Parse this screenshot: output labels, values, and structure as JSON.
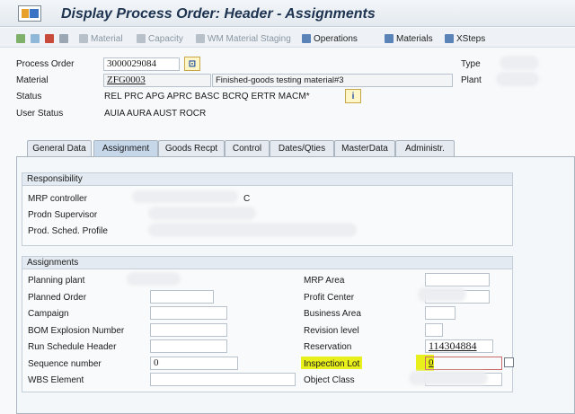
{
  "title": "Display Process Order: Header - Assignments",
  "toolbar": {
    "items": [
      {
        "label": "Material",
        "dim": true,
        "icon": "material-icon",
        "color": "#9aa6b2"
      },
      {
        "label": "Capacity",
        "dim": true,
        "icon": "capacity-icon",
        "color": "#9aa6b2"
      },
      {
        "label": "WM Material Staging",
        "dim": true,
        "icon": "wm-staging-icon",
        "color": "#9aa6b2"
      },
      {
        "label": "Operations",
        "dim": false,
        "icon": "operations-icon",
        "color": "#3a72c4"
      },
      {
        "label": "Materials",
        "dim": false,
        "icon": "materials-icon",
        "color": "#3a72c4"
      },
      {
        "label": "XSteps",
        "dim": false,
        "icon": "xsteps-icon",
        "color": "#3a72c4"
      }
    ]
  },
  "header": {
    "process_order_label": "Process Order",
    "process_order_value": "3000029084",
    "type_label": "Type",
    "material_label": "Material",
    "material_value": "ZFG0003",
    "material_desc": "Finished-goods testing material#3",
    "plant_label": "Plant",
    "status_label": "Status",
    "status_value": "REL  PRC  APG  APRC BASC BCRQ ERTR MACM*",
    "user_status_label": "User Status",
    "user_status_value": "AUIA AURA AUST ROCR",
    "info_icon": "i"
  },
  "tabs": [
    {
      "label": "General Data",
      "active": false
    },
    {
      "label": "Assignment",
      "active": true
    },
    {
      "label": "Goods Recpt",
      "active": false
    },
    {
      "label": "Control",
      "active": false
    },
    {
      "label": "Dates/Qties",
      "active": false
    },
    {
      "label": "MasterData",
      "active": false
    },
    {
      "label": "Administr.",
      "active": false
    }
  ],
  "responsibility": {
    "title": "Responsibility",
    "mrp_controller_label": "MRP controller",
    "mrp_controller_suffix": "C",
    "prodn_supervisor_label": "Prodn Supervisor",
    "prod_sched_profile_label": "Prod. Sched. Profile"
  },
  "assignments": {
    "title": "Assignments",
    "planning_plant_label": "Planning plant",
    "planned_order_label": "Planned Order",
    "campaign_label": "Campaign",
    "bom_explosion_label": "BOM Explosion Number",
    "run_schedule_label": "Run Schedule Header",
    "sequence_number_label": "Sequence number",
    "sequence_number_value": "0",
    "wbs_element_label": "WBS Element",
    "mrp_area_label": "MRP Area",
    "profit_center_label": "Profit Center",
    "business_area_label": "Business Area",
    "revision_level_label": "Revision level",
    "reservation_label": "Reservation",
    "reservation_value": "114304884",
    "inspection_lot_label": "Inspection Lot",
    "inspection_lot_value": "0",
    "object_class_label": "Object Class"
  },
  "colors": {
    "highlight": "#e8ef1a",
    "active_tab": "#c6d7ea"
  }
}
